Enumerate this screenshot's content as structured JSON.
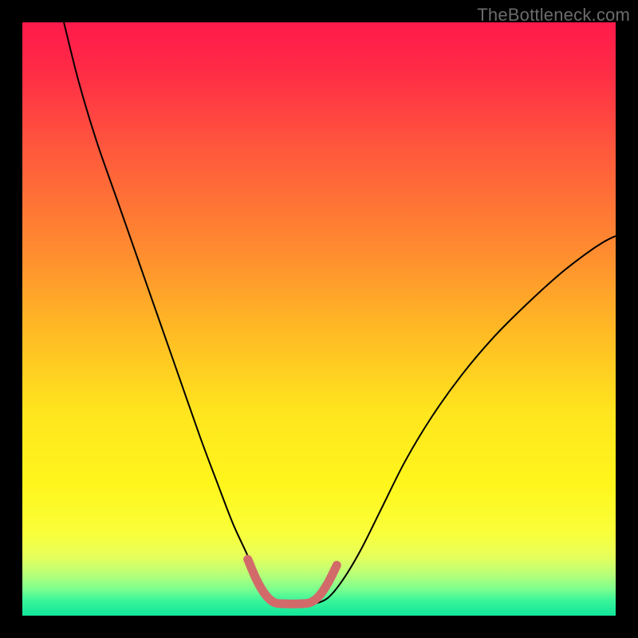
{
  "watermark": {
    "text": "TheBottleneck.com"
  },
  "chart_data": {
    "type": "line",
    "title": "",
    "xlabel": "",
    "ylabel": "",
    "xlim": [
      0,
      100
    ],
    "ylim": [
      0,
      100
    ],
    "grid": false,
    "legend": false,
    "annotations": [],
    "background": {
      "type": "vertical-gradient",
      "stops": [
        {
          "t": 0.0,
          "color": "#ff1a4b"
        },
        {
          "t": 0.08,
          "color": "#ff2b46"
        },
        {
          "t": 0.22,
          "color": "#ff5a3c"
        },
        {
          "t": 0.38,
          "color": "#ff8a30"
        },
        {
          "t": 0.52,
          "color": "#ffba24"
        },
        {
          "t": 0.66,
          "color": "#ffe61e"
        },
        {
          "t": 0.78,
          "color": "#fff61c"
        },
        {
          "t": 0.86,
          "color": "#faff3a"
        },
        {
          "t": 0.9,
          "color": "#e7ff5a"
        },
        {
          "t": 0.93,
          "color": "#b8ff78"
        },
        {
          "t": 0.955,
          "color": "#7dff8e"
        },
        {
          "t": 0.975,
          "color": "#38f59a"
        },
        {
          "t": 1.0,
          "color": "#12e59a"
        }
      ]
    },
    "series": [
      {
        "name": "bottleneck-curve",
        "stroke": "#000000",
        "stroke_width": 2,
        "fill": "none",
        "x": [
          7.0,
          9.5,
          12.5,
          16.0,
          19.5,
          23.0,
          26.5,
          30.0,
          33.0,
          35.5,
          37.8,
          39.5,
          41.0,
          42.2,
          44.0,
          46.5,
          49.0,
          51.5,
          54.0,
          57.0,
          60.5,
          64.5,
          69.0,
          74.0,
          79.5,
          85.0,
          90.5,
          95.0,
          98.0,
          100.0
        ],
        "y": [
          100.0,
          90.0,
          80.0,
          70.0,
          60.0,
          50.0,
          40.0,
          30.0,
          22.0,
          15.5,
          10.5,
          6.5,
          3.5,
          2.0,
          2.0,
          2.0,
          2.0,
          3.0,
          6.0,
          11.0,
          18.0,
          26.0,
          33.5,
          40.5,
          47.0,
          52.5,
          57.5,
          61.0,
          63.0,
          64.0
        ]
      },
      {
        "name": "highlight-valley",
        "stroke": "#d26a6a",
        "stroke_width": 11,
        "fill": "none",
        "linecap": "round",
        "x": [
          38.0,
          39.5,
          41.0,
          42.5,
          44.5,
          46.5,
          48.5,
          50.0,
          51.5,
          53.0
        ],
        "y": [
          9.5,
          6.0,
          3.5,
          2.2,
          2.0,
          2.0,
          2.2,
          3.3,
          5.5,
          8.5
        ]
      }
    ]
  }
}
